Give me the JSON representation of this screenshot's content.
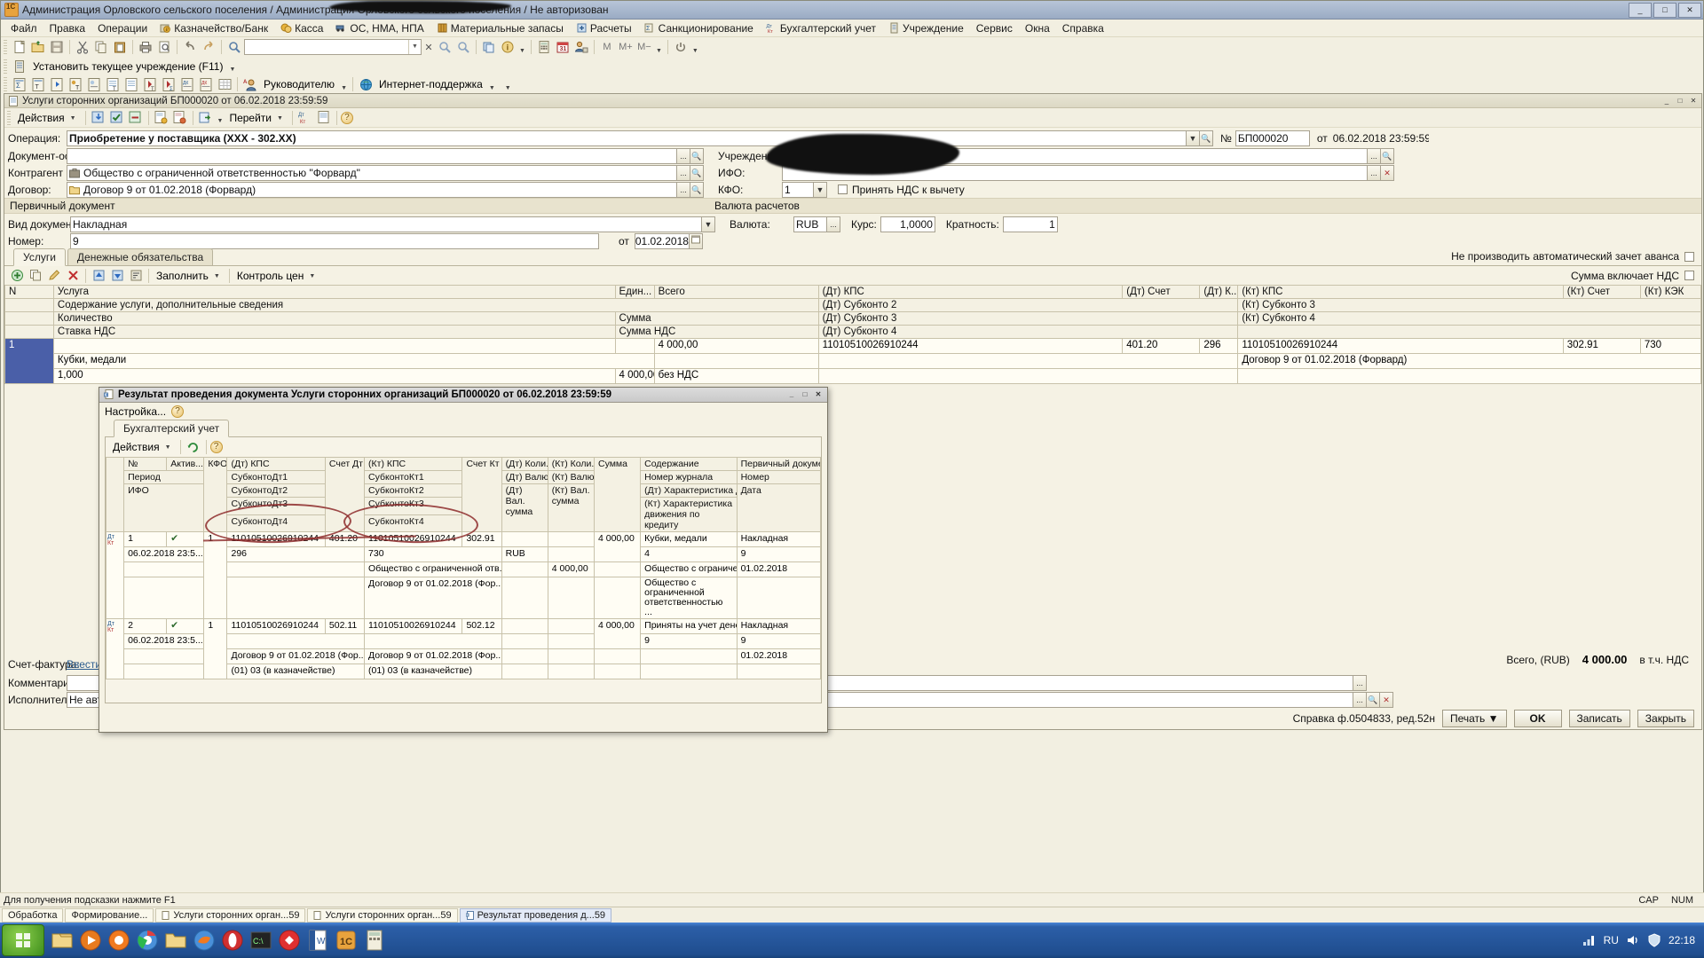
{
  "window": {
    "title": "Администрация Орловского сельского поселения / Администрация Орловского сельского поселения / Не авторизован",
    "min": "_",
    "max": "□",
    "close": "✕"
  },
  "menu": [
    {
      "label": "Файл",
      "icon": ""
    },
    {
      "label": "Правка",
      "icon": ""
    },
    {
      "label": "Операции",
      "icon": ""
    },
    {
      "label": "Казначейство/Банк",
      "icon": "bank-icon"
    },
    {
      "label": "Касса",
      "icon": "cash-icon"
    },
    {
      "label": "ОС, НМА, НПА",
      "icon": "assets-icon"
    },
    {
      "label": "Материальные запасы",
      "icon": "materials-icon"
    },
    {
      "label": "Расчеты",
      "icon": "settlements-icon"
    },
    {
      "label": "Санкционирование",
      "icon": "sanction-icon"
    },
    {
      "label": "Бухгалтерский учет",
      "icon": "accounting-icon"
    },
    {
      "label": "Учреждение",
      "icon": "institution-icon"
    },
    {
      "label": "Сервис",
      "icon": ""
    },
    {
      "label": "Окна",
      "icon": ""
    },
    {
      "label": "Справка",
      "icon": ""
    }
  ],
  "toolbar2": {
    "set_institution": "Установить текущее учреждение (F11)",
    "manager": "Руководителю",
    "support": "Интернет-поддержка"
  },
  "search": {
    "value": "",
    "placeholder": ""
  },
  "document": {
    "title": "Услуги сторонних организаций БП000020 от 06.02.2018 23:59:59",
    "actions_label": "Действия",
    "goto_label": "Перейти",
    "min": "_",
    "max": "□",
    "close": "✕"
  },
  "header": {
    "operation_label": "Операция:",
    "operation_value": "Приобретение у поставщика (XXX - 302.XX)",
    "doc_basis_label": "Документ-ос...",
    "doc_basis_value": "",
    "counterparty_label": "Контрагент",
    "counterparty_value": "Общество с ограниченной ответственностью \"Форвард\"",
    "contract_label": "Договор:",
    "contract_value": "Договор 9 от 01.02.2018 (Форвард)",
    "number_label": "№",
    "number_value": "БП000020",
    "date_prefix": "от",
    "date_value": "06.02.2018 23:59:59",
    "institution_label": "Учреждение:",
    "institution_value": "",
    "ifo_label": "ИФО:",
    "ifo_value": "",
    "kfo_label": "КФО:",
    "kfo_value": "1",
    "vat_deduct_label": "Принять НДС к вычету",
    "vat_deduct_checked": false
  },
  "primary_doc": {
    "section_title": "Первичный документ",
    "type_label": "Вид документа:",
    "type_value": "Накладная",
    "number_label": "Номер:",
    "number_value": "9",
    "date_prefix": "от",
    "date_value": "01.02.2018"
  },
  "currency": {
    "section_title": "Валюта расчетов",
    "currency_label": "Валюта:",
    "currency_value": "RUB",
    "rate_label": "Курс:",
    "rate_value": "1,0000",
    "multiplicity_label": "Кратность:",
    "multiplicity_value": "1"
  },
  "options": {
    "no_auto_advance_offset": "Не производить автоматический зачет аванса",
    "no_auto_advance_checked": false,
    "sum_includes_vat": "Сумма включает НДС",
    "sum_includes_vat_checked": false
  },
  "tabs": [
    {
      "label": "Услуги",
      "active": true
    },
    {
      "label": "Денежные обязательства",
      "active": false
    }
  ],
  "grid_toolbar": {
    "fill_label": "Заполнить",
    "price_control_label": "Контроль цен"
  },
  "services_table": {
    "headers_row1": [
      "N",
      "Услуга",
      "Един...",
      "Всего",
      "(Дт) КПС",
      "(Дт) Счет",
      "(Дт) К...",
      "(Кт) КПС",
      "(Кт) Счет",
      "(Кт) КЭК"
    ],
    "headers_row2": [
      "",
      "Содержание услуги, дополнительные сведения",
      "",
      "",
      "(Дт) Субконто 2",
      "",
      "",
      "(Кт) Субконто 3",
      "",
      ""
    ],
    "headers_row3": [
      "",
      "Количество",
      "Сумма",
      "Ставка НДС",
      "Сумма НДС",
      "(Дт) Субконто 3",
      "",
      "(Кт) Субконто 4",
      "",
      ""
    ],
    "headers_row4": [
      "",
      "",
      "",
      "",
      "",
      "(Дт) Субконто 4",
      "",
      "",
      "",
      ""
    ],
    "rows": [
      {
        "n": "1",
        "service": "",
        "unit": "",
        "total": "4 000,00",
        "dt_kps": "11010510026910244",
        "dt_account": "401.20",
        "dt_kek": "296",
        "kt_kps": "11010510026910244",
        "kt_account": "302.91",
        "kt_kek": "730",
        "content": "Кубки, медали",
        "quantity": "1,000",
        "amount": "4 000,00",
        "vat_rate": "без НДС",
        "vat_amount": "",
        "kt_subconto3": "Договор 9 от 01.02.2018 (Форвард)"
      }
    ]
  },
  "footer": {
    "invoice_label": "Счет-фактура:",
    "invoice_link": "Ввести с...",
    "comment_label": "Комментарий:",
    "comment_value": "",
    "executor_label": "Исполнитель:",
    "executor_value": "Не автор",
    "total_label": "Всего, (RUB)",
    "total_value": "4 000.00",
    "vat_note": "в т.ч. НДС",
    "reference": "Справка ф.0504833, ред.52н",
    "print_label": "Печать",
    "ok_label": "OK",
    "save_label": "Записать",
    "close_label": "Закрыть"
  },
  "modal": {
    "title": "Результат проведения документа Услуги сторонних организаций БП000020 от 06.02.2018 23:59:59",
    "settings_label": "Настройка...",
    "tab_label": "Бухгалтерский учет",
    "actions_label": "Действия",
    "columns": [
      {
        "l1": "№",
        "l2": "Период",
        "l3": "ИФО",
        "l4": "",
        "l5": ""
      },
      {
        "l1": "Актив...",
        "l2": "",
        "l3": "",
        "l4": "",
        "l5": ""
      },
      {
        "l1": "КФО",
        "l2": "",
        "l3": "",
        "l4": "",
        "l5": ""
      },
      {
        "l1": "(Дт) КПС",
        "l2": "СубконтоДт1",
        "l3": "СубконтоДт2",
        "l4": "СубконтоДт3",
        "l5": "СубконтоДт4"
      },
      {
        "l1": "Счет Дт",
        "l2": "",
        "l3": "",
        "l4": "",
        "l5": ""
      },
      {
        "l1": "(Кт) КПС",
        "l2": "СубконтоКт1",
        "l3": "СубконтоКт2",
        "l4": "СубконтоКт3",
        "l5": "СубконтоКт4"
      },
      {
        "l1": "Счет Кт",
        "l2": "",
        "l3": "",
        "l4": "",
        "l5": ""
      },
      {
        "l1": "(Дт) Коли...",
        "l2": "(Дт) Валю...",
        "l3": "(Дт) Вал. сумма",
        "l4": "",
        "l5": ""
      },
      {
        "l1": "(Кт) Коли...",
        "l2": "(Кт) Валю...",
        "l3": "(Кт) Вал. сумма",
        "l4": "",
        "l5": ""
      },
      {
        "l1": "Сумма",
        "l2": "",
        "l3": "",
        "l4": "",
        "l5": ""
      },
      {
        "l1": "Содержание",
        "l2": "Номер журнала",
        "l3": "(Дт) Характеристика дви...",
        "l4": "(Кт) Характеристика движения по кредиту",
        "l5": ""
      },
      {
        "l1": "Первичный докуме...",
        "l2": "Номер",
        "l3": "Дата",
        "l4": "",
        "l5": ""
      }
    ],
    "rows": [
      {
        "marker": "Дт\nКт",
        "n": "1",
        "active": "✔",
        "kfo": "1",
        "period": "06.02.2018 23:5...",
        "ifo": "",
        "dt_kps": "11010510026910244",
        "dt_account": "401.20",
        "dt_sub1": "296",
        "dt_sub2": "",
        "dt_sub3": "",
        "dt_sub4": "",
        "kt_kps": "11010510026910244",
        "kt_account": "302.91",
        "kt_sub1": "730",
        "kt_sub2": "Общество с ограниченной отв...",
        "kt_sub3": "Договор 9 от 01.02.2018 (Фор...",
        "kt_sub4": "",
        "dt_qty": "",
        "dt_currency": "RUB",
        "dt_cur_sum": "4 000,00",
        "sum": "4 000,00",
        "content1": "Кубки, медали",
        "content2": "4",
        "content3": "Общество с ограниченн...",
        "content4": "Общество с ограниченной ответственностью ...",
        "primary1": "Накладная",
        "primary2": "9",
        "primary3": "01.02.2018",
        "circled": false
      },
      {
        "marker": "Дт\nКт",
        "n": "2",
        "active": "✔",
        "kfo": "1",
        "period": "06.02.2018 23:5...",
        "ifo": "",
        "dt_kps": "11010510026910244",
        "dt_account": "502.11",
        "dt_sub1": "",
        "dt_sub2": "Договор 9 от 01.02.2018 (Фор...",
        "dt_sub3": "(01) 03 (в казначействе)",
        "dt_sub4": "",
        "kt_kps": "11010510026910244",
        "kt_account": "502.12",
        "kt_sub1": "",
        "kt_sub2": "Договор 9 от 01.02.2018 (Фор...",
        "kt_sub3": "(01) 03 (в казначействе)",
        "kt_sub4": "",
        "dt_qty": "",
        "dt_currency": "",
        "dt_cur_sum": "",
        "sum": "4 000,00",
        "content1": "Приняты на учет денежн...",
        "content2": "9",
        "content3": "",
        "content4": "",
        "primary1": "Накладная",
        "primary2": "9",
        "primary3": "01.02.2018",
        "circled": true
      }
    ]
  },
  "taskbar": {
    "items": [
      {
        "label": "Обработка",
        "active": false
      },
      {
        "label": "Формирование...",
        "active": false
      },
      {
        "label": "Услуги сторонних орган...59",
        "active": false
      },
      {
        "label": "Услуги сторонних орган...59",
        "active": false
      },
      {
        "label": "Результат проведения д...59",
        "active": true
      }
    ]
  },
  "statusbar": {
    "hint": "Для получения подсказки нажмите F1",
    "caps": "CAP",
    "num": "NUM"
  },
  "systray": {
    "lang": "RU",
    "time": "22:18"
  },
  "colors": {
    "accent": "#3a6ea5",
    "form_bg": "#f5f2e4",
    "field_bg": "#ffffff",
    "ink": "#8d2b2b",
    "selection": "#4a5fa8"
  }
}
